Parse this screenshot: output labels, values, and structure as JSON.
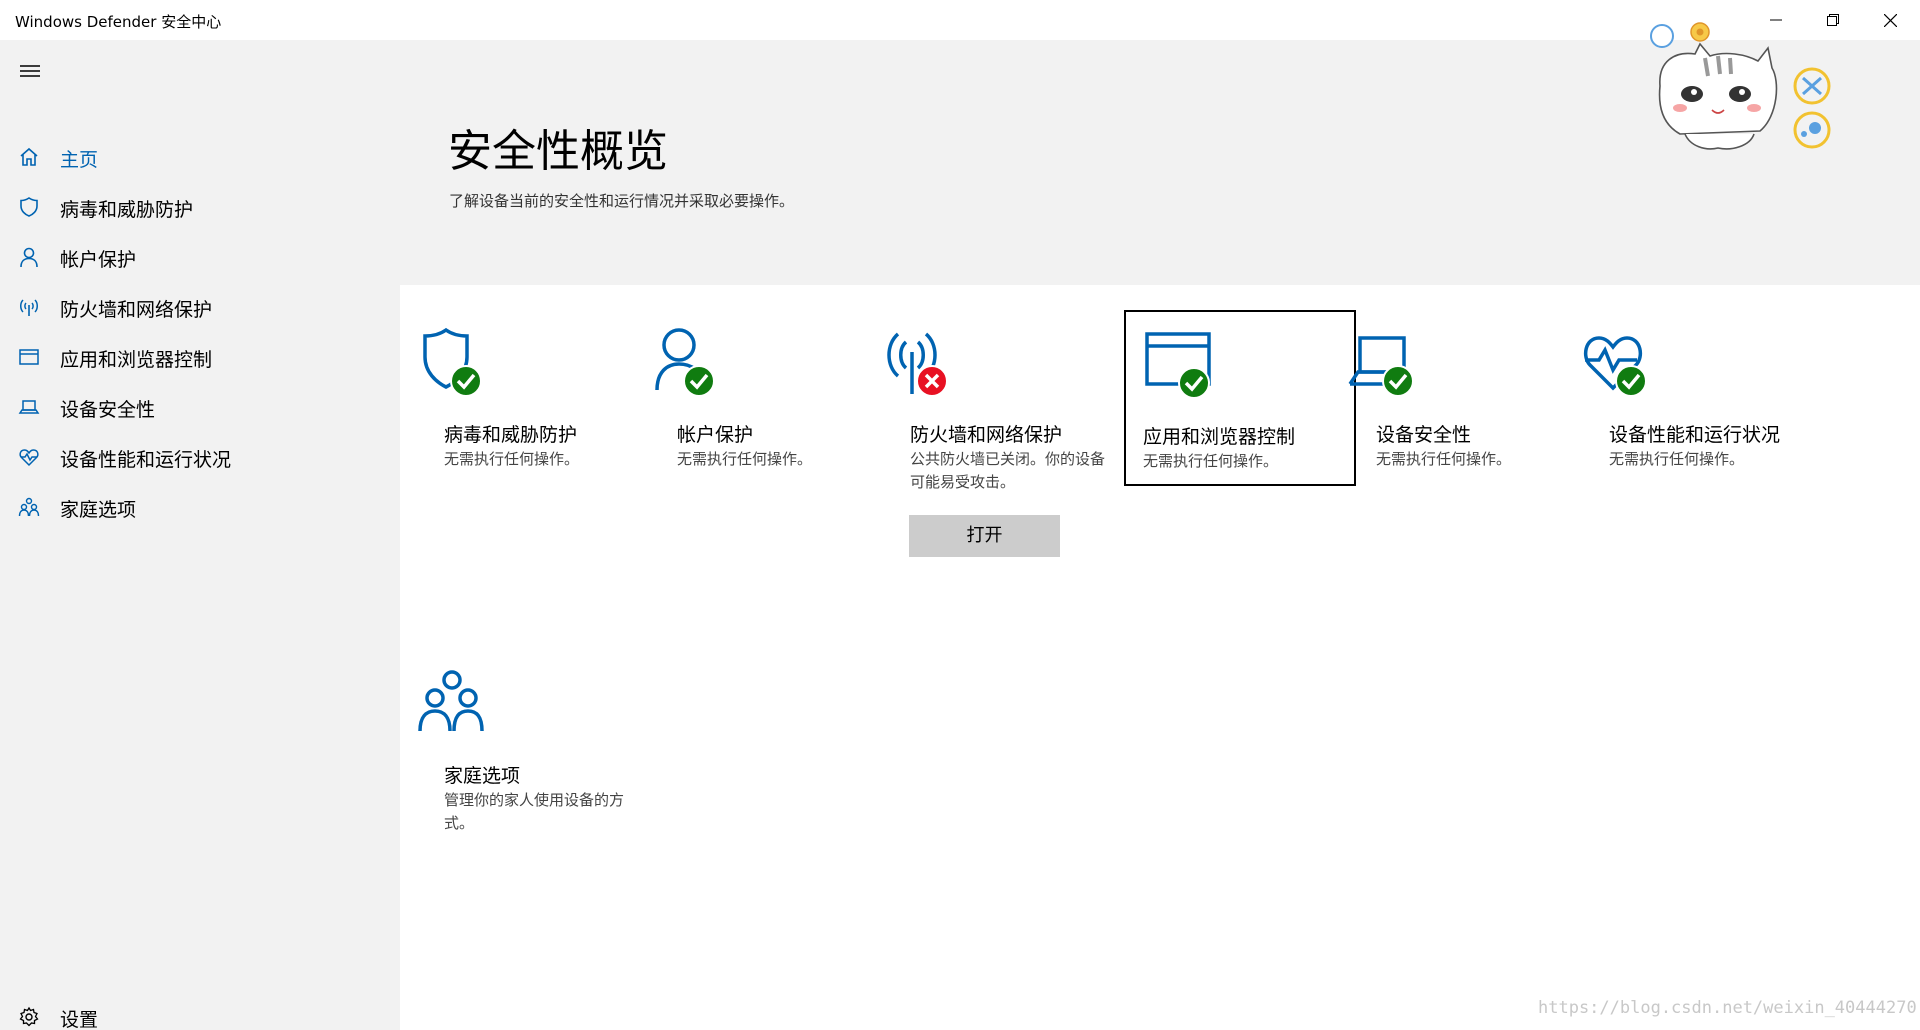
{
  "window": {
    "title": "Windows Defender 安全中心",
    "minimize_icon": "minimize-icon",
    "restore_icon": "restore-icon",
    "close_icon": "close-icon"
  },
  "colors": {
    "accent": "#0063b1",
    "ok": "#107c10",
    "error": "#e81123",
    "sidebar_bg": "#f2f2f2",
    "button_bg": "#cccccc"
  },
  "sidebar": {
    "menu_icon": "hamburger-icon",
    "items": [
      {
        "label": "主页",
        "icon": "home-icon",
        "active": true
      },
      {
        "label": "病毒和威胁防护",
        "icon": "shield-icon",
        "active": false
      },
      {
        "label": "帐户保护",
        "icon": "person-icon",
        "active": false
      },
      {
        "label": "防火墙和网络保护",
        "icon": "wifi-antenna-icon",
        "active": false
      },
      {
        "label": "应用和浏览器控制",
        "icon": "browser-window-icon",
        "active": false
      },
      {
        "label": "设备安全性",
        "icon": "laptop-icon",
        "active": false
      },
      {
        "label": "设备性能和运行状况",
        "icon": "heart-pulse-icon",
        "active": false
      },
      {
        "label": "家庭选项",
        "icon": "family-icon",
        "active": false
      }
    ],
    "settings": {
      "label": "设置",
      "icon": "gear-icon"
    }
  },
  "main": {
    "title": "安全性概览",
    "subtitle": "了解设备当前的安全性和运行情况并采取必要操作。",
    "tiles": [
      {
        "title": "病毒和威胁防护",
        "desc": "无需执行任何操作。",
        "icon": "shield-icon",
        "status": "ok"
      },
      {
        "title": "帐户保护",
        "desc": "无需执行任何操作。",
        "icon": "person-icon",
        "status": "ok"
      },
      {
        "title": "防火墙和网络保护",
        "desc": "公共防火墙已关闭。你的设备可能易受攻击。",
        "icon": "wifi-antenna-icon",
        "status": "error",
        "button": "打开"
      },
      {
        "title": "应用和浏览器控制",
        "desc": "无需执行任何操作。",
        "icon": "browser-window-icon",
        "status": "ok"
      },
      {
        "title": "设备安全性",
        "desc": "无需执行任何操作。",
        "icon": "laptop-icon",
        "status": "ok"
      },
      {
        "title": "设备性能和运行状况",
        "desc": "无需执行任何操作。",
        "icon": "heart-pulse-icon",
        "status": "ok"
      },
      {
        "title": "家庭选项",
        "desc": "管理你的家人使用设备的方式。",
        "icon": "family-icon",
        "status": "none"
      }
    ]
  },
  "watermark": "https://blog.csdn.net/weixin_40444270"
}
